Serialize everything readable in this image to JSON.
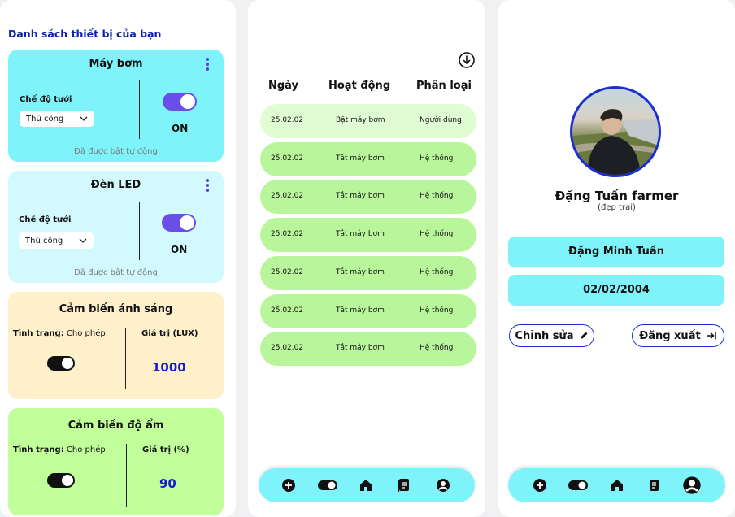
{
  "device_list": {
    "title": "Danh sách thiết bị của bạn",
    "pump": {
      "name": "Máy bơm",
      "mode_label": "Chế độ tưới",
      "mode_value": "Thủ công",
      "state": "ON",
      "note": "Đã được bật tự động"
    },
    "led": {
      "name": "Đèn LED",
      "mode_label": "Chế độ tưới",
      "mode_value": "Thủ công",
      "state": "ON",
      "note": "Đã được bật tự động"
    },
    "light_sensor": {
      "name": "Cảm biến ánh sáng",
      "status_label": "Tình trạng:",
      "status_value": "Cho phép",
      "value_label": "Giá trị (LUX)",
      "value": "1000"
    },
    "humidity_sensor": {
      "name": "Cảm biến độ ẩm",
      "status_label": "Tình trạng:",
      "status_value": "Cho phép",
      "value_label": "Giá trị (%)",
      "value": "90"
    }
  },
  "history": {
    "columns": [
      "Ngày",
      "Hoạt động",
      "Phân loại"
    ],
    "rows": [
      {
        "date": "25.02.02",
        "action": "Bật máy bơm",
        "type": "Người dùng"
      },
      {
        "date": "25.02.02",
        "action": "Tắt máy bơm",
        "type": "Hệ thống"
      },
      {
        "date": "25.02.02",
        "action": "Tắt máy bơm",
        "type": "Hệ thống"
      },
      {
        "date": "25.02.02",
        "action": "Tắt máy bơm",
        "type": "Hệ thống"
      },
      {
        "date": "25.02.02",
        "action": "Tắt máy bơm",
        "type": "Hệ thống"
      },
      {
        "date": "25.02.02",
        "action": "Tắt máy bơm",
        "type": "Hệ thống"
      },
      {
        "date": "25.02.02",
        "action": "Tắt máy bơm",
        "type": "Hệ thống"
      }
    ]
  },
  "profile": {
    "display_name": "Đặng Tuấn farmer",
    "subtitle": "(đẹp trai)",
    "full_name": "Đặng Minh Tuấn",
    "birthday": "02/02/2004",
    "edit_label": "Chỉnh sửa",
    "logout_label": "Đăng xuất"
  },
  "nav_icons": [
    "plus-icon",
    "toggle-icon",
    "home-icon",
    "document-icon",
    "user-icon"
  ],
  "colors": {
    "cyan": "#7ef3fa",
    "light_cyan": "#d2fafe",
    "peach": "#fff0cc",
    "green": "#c1ff9a",
    "purple": "#6a4ee8",
    "row_green": "#b9f59b",
    "blue": "#1b2fd1"
  }
}
